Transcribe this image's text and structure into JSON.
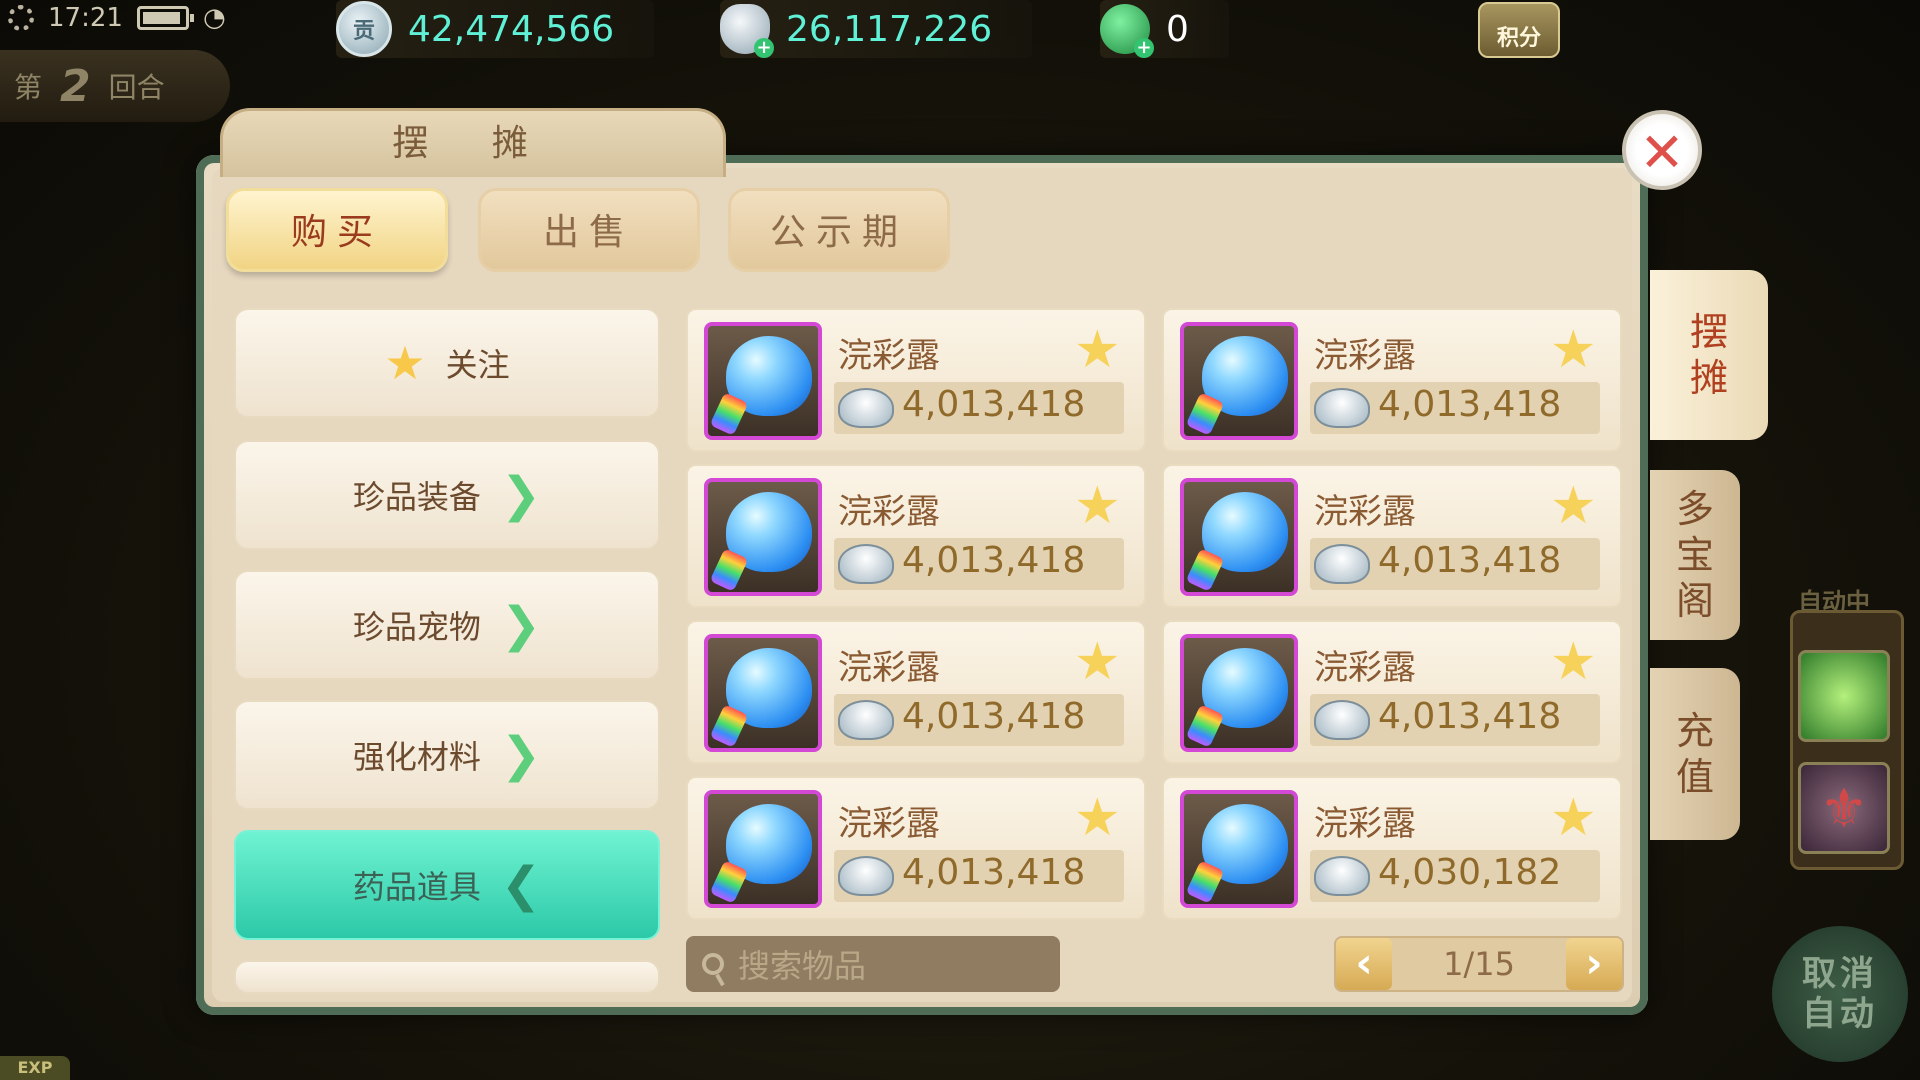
{
  "status_bar": {
    "time": "17:21"
  },
  "round": {
    "prefix": "第",
    "number": "2",
    "suffix": "回合"
  },
  "currencies": [
    {
      "icon": "contribution-coin-icon",
      "glyph": "贡",
      "value": "42,474,566"
    },
    {
      "icon": "silver-ingot-icon",
      "value": "26,117,226"
    },
    {
      "icon": "jade-coin-icon",
      "value": "0"
    }
  ],
  "points_badge": "积分",
  "panel": {
    "title": "摆 摊",
    "tabs": [
      {
        "label": "购买",
        "active": true
      },
      {
        "label": "出售",
        "active": false
      },
      {
        "label": "公示期",
        "active": false
      }
    ],
    "categories": [
      {
        "label": "关注",
        "icon": "star-icon"
      },
      {
        "label": "珍品装备",
        "icon": "chevron-right-icon"
      },
      {
        "label": "珍品宠物",
        "icon": "chevron-right-icon"
      },
      {
        "label": "强化材料",
        "icon": "chevron-right-icon"
      },
      {
        "label": "药品道具",
        "icon": "chevron-left-icon",
        "active": true
      }
    ],
    "items": [
      {
        "name": "浣彩露",
        "price": "4,013,418"
      },
      {
        "name": "浣彩露",
        "price": "4,013,418"
      },
      {
        "name": "浣彩露",
        "price": "4,013,418"
      },
      {
        "name": "浣彩露",
        "price": "4,013,418"
      },
      {
        "name": "浣彩露",
        "price": "4,013,418"
      },
      {
        "name": "浣彩露",
        "price": "4,013,418"
      },
      {
        "name": "浣彩露",
        "price": "4,013,418"
      },
      {
        "name": "浣彩露",
        "price": "4,030,182"
      }
    ],
    "search": {
      "placeholder": "搜索物品"
    },
    "pager": {
      "text": "1/15"
    }
  },
  "side_tabs": [
    {
      "label": "摆\n摊",
      "active": true
    },
    {
      "label": "多\n宝\n阁",
      "active": false
    },
    {
      "label": "充\n值",
      "active": false
    }
  ],
  "hud": {
    "auto_label": "自动中",
    "cancel_auto": [
      "取消",
      "自动"
    ],
    "exp": "EXP"
  },
  "colors": {
    "accent_teal": "#5ff0d6",
    "item_border": "#d349d6",
    "close_red": "#e0504a"
  }
}
